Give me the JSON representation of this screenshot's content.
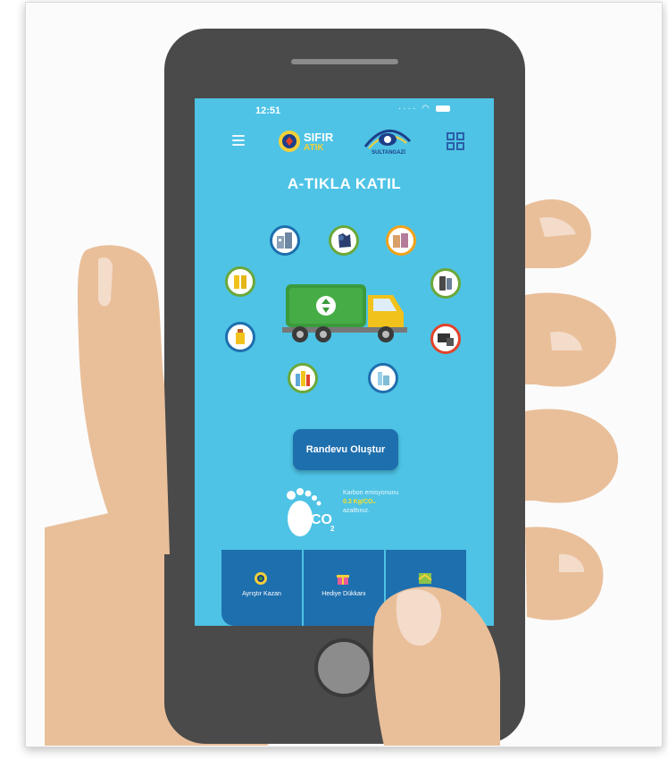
{
  "status_bar": {
    "time": "12:51",
    "icons": [
      "wifi-icon",
      "battery-icon"
    ]
  },
  "header": {
    "logo_sifir_line1": "SIFIR",
    "logo_sifir_line2": "ATIK",
    "logo_sultangazi": "SULTANGAZİ"
  },
  "title": "A-TIKLA KATIL",
  "waste_categories": [
    "building-waste-icon",
    "clothing-waste-icon",
    "paper-waste-icon",
    "battery-waste-icon",
    "phone-waste-icon",
    "oil-waste-icon",
    "electronics-waste-icon",
    "plastic-bottle-waste-icon",
    "glass-waste-icon"
  ],
  "appointment_button": "Randevu Oluştur",
  "carbon": {
    "line1": "Karbon emisyonunu",
    "amount": "0.3 Kg/CO₂",
    "line3": "azalttınız.",
    "co2_label": "CO",
    "co2_sub": "2"
  },
  "bottom_nav": [
    {
      "label": "Ayrıştır Kazan"
    },
    {
      "label": "Hediye Dükkanı"
    },
    {
      "label": "Neredeyim?",
      "label_visible": "Ne          ım?"
    }
  ],
  "colors": {
    "screen_bg": "#4ec3e5",
    "button_blue": "#1e6fae",
    "truck_green": "#3b9a3b",
    "truck_yellow": "#f1c21b",
    "phone_body": "#4a4a4a",
    "skin": "#e9bf9a"
  }
}
